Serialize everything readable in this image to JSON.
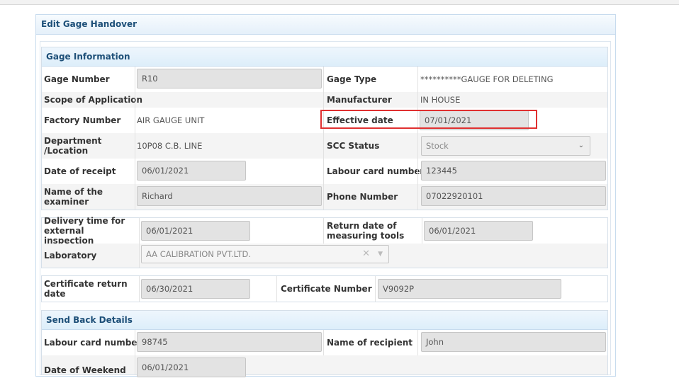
{
  "panel": {
    "title": "Edit Gage Handover"
  },
  "gage_info": {
    "title": "Gage Information",
    "gage_number_label": "Gage Number",
    "gage_number": "R10",
    "gage_type_label": "Gage Type",
    "gage_type": "**********GAUGE FOR DELETING",
    "scope_label": "Scope of Application",
    "manufacturer_label": "Manufacturer",
    "manufacturer": "IN HOUSE",
    "factory_number_label": "Factory Number",
    "factory_number": "AIR GAUGE UNIT",
    "effective_date_label": "Effective date",
    "effective_date": "07/01/2021",
    "department_label": "Department /Location",
    "department": "10P08 C.B. LINE",
    "scc_status_label": "SCC Status",
    "scc_status": "Stock",
    "date_receipt_label": "Date of receipt",
    "date_receipt": "06/01/2021",
    "labour_card_label": "Labour card number",
    "labour_card": "123445",
    "examiner_label": "Name of the examiner",
    "examiner": "Richard",
    "phone_label": "Phone Number",
    "phone": "07022920101"
  },
  "inspection": {
    "delivery_label": "Delivery time for external inspection",
    "delivery": "06/01/2021",
    "return_label": "Return date of measuring tools",
    "return_date": "06/01/2021",
    "laboratory_label": "Laboratory",
    "laboratory": "AA CALIBRATION PVT.LTD."
  },
  "certificate": {
    "return_label": "Certificate return date",
    "return_date": "06/30/2021",
    "number_label": "Certificate Number",
    "number": "V9092P"
  },
  "send_back": {
    "title": "Send Back Details",
    "labour_card_label": "Labour card number",
    "labour_card": "98745",
    "recipient_label": "Name of recipient",
    "recipient": "John",
    "partial_label": "Date of Weekend",
    "partial_value": "06/01/2021"
  },
  "icons": {
    "dropdown": "chevron-down-icon",
    "clear": "clear-x-icon",
    "select_arrow": "caret-down-icon"
  },
  "colors": {
    "section_title": "#1d4f78",
    "highlight": "#e03030",
    "input_bg": "#e3e3e3"
  }
}
